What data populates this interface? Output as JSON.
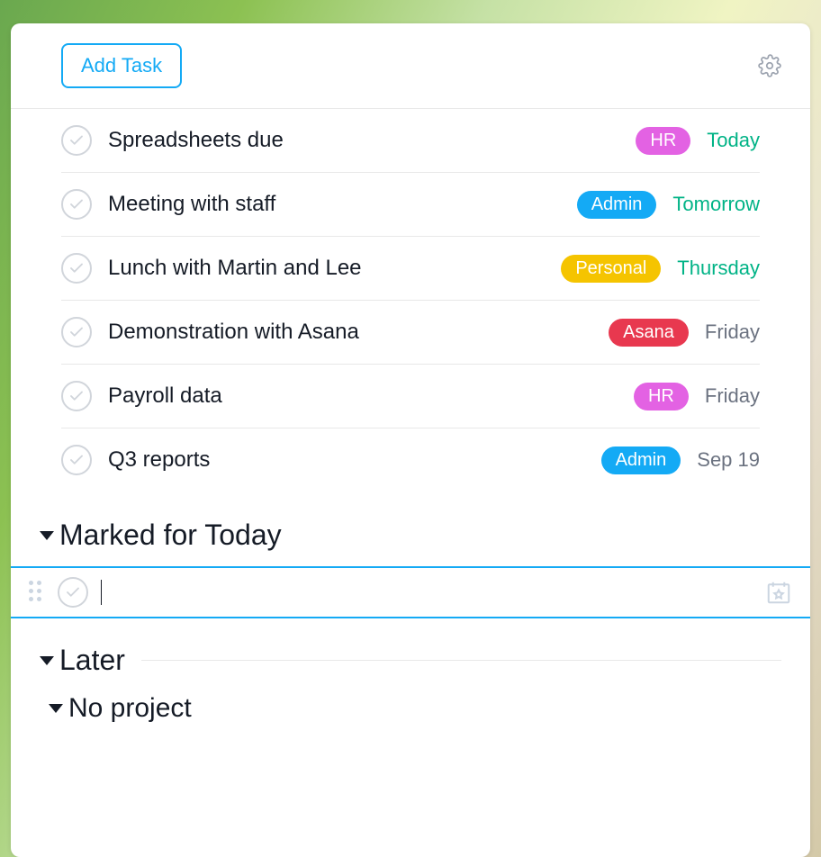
{
  "header": {
    "add_task_label": "Add Task"
  },
  "tag_colors": {
    "hr": "#e362e3",
    "admin": "#14aaf5",
    "personal": "#f5c400",
    "asana": "#e8384f"
  },
  "tasks": [
    {
      "title": "Spreadsheets due",
      "tag": "HR",
      "tag_color_key": "hr",
      "due": "Today",
      "due_style": "green"
    },
    {
      "title": "Meeting with staff",
      "tag": "Admin",
      "tag_color_key": "admin",
      "due": "Tomorrow",
      "due_style": "green"
    },
    {
      "title": "Lunch with Martin and Lee",
      "tag": "Personal",
      "tag_color_key": "personal",
      "due": "Thursday",
      "due_style": "green"
    },
    {
      "title": "Demonstration with Asana",
      "tag": "Asana",
      "tag_color_key": "asana",
      "due": "Friday",
      "due_style": "gray"
    },
    {
      "title": "Payroll data",
      "tag": "HR",
      "tag_color_key": "hr",
      "due": "Friday",
      "due_style": "gray"
    },
    {
      "title": "Q3 reports",
      "tag": "Admin",
      "tag_color_key": "admin",
      "due": "Sep 19",
      "due_style": "gray"
    }
  ],
  "sections": {
    "marked_for_today": "Marked for Today",
    "later": "Later",
    "no_project": "No project"
  },
  "new_task": {
    "value": ""
  }
}
